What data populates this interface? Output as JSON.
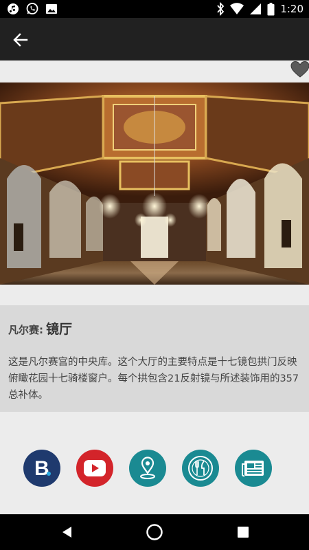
{
  "status_bar": {
    "time": "1:20",
    "left_icons": [
      "music-app-icon",
      "whatsapp-icon",
      "image-icon"
    ],
    "right_icons": [
      "bluetooth-icon",
      "wifi-icon",
      "cell-signal-icon",
      "battery-icon"
    ]
  },
  "app_bar": {
    "back_icon": "arrow-left-icon"
  },
  "favorite": {
    "icon": "heart-icon",
    "color": "#5a5a5a"
  },
  "hero": {
    "subject": "hall-of-mirrors-photo"
  },
  "info": {
    "title_prefix": "凡尔赛:",
    "title_main": "镜厅",
    "description": "这是凡尔赛宫的中央库。这个大厅的主要特点是十七镜包拱门反映俯瞰花园十七骑楼窗户。每个拱包含21反射镜与所述装饰用的357总补体。"
  },
  "actions": [
    {
      "name": "booking-button",
      "icon": "booking-b-icon",
      "color": "#1f3a6e"
    },
    {
      "name": "youtube-button",
      "icon": "youtube-play-icon",
      "color": "#d3242a"
    },
    {
      "name": "map-button",
      "icon": "map-pin-icon",
      "color": "#1a8a92"
    },
    {
      "name": "restaurant-button",
      "icon": "fork-knife-icon",
      "color": "#1a8a92"
    },
    {
      "name": "news-button",
      "icon": "newspaper-icon",
      "color": "#1a8a92"
    }
  ],
  "nav_bar": {
    "buttons": [
      "back-triangle-icon",
      "home-circle-icon",
      "recents-square-icon"
    ]
  }
}
